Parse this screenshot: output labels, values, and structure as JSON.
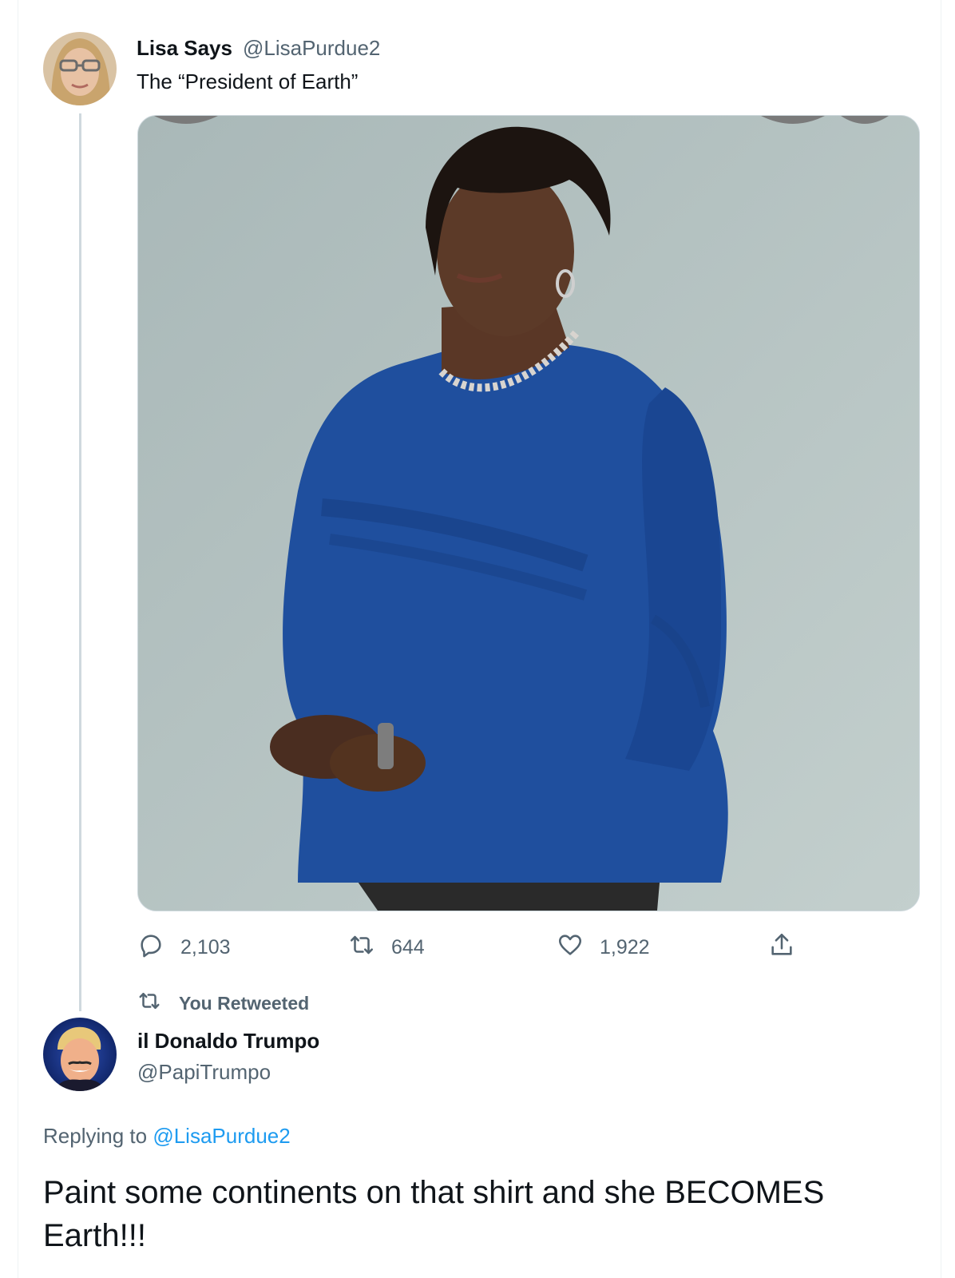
{
  "tweet1": {
    "author_name": "Lisa Says",
    "author_handle": "@LisaPurdue2",
    "text": "The “President of Earth”",
    "stats": {
      "replies": "2,103",
      "retweets": "644",
      "likes": "1,922"
    }
  },
  "retweet_context": {
    "label": "You Retweeted"
  },
  "tweet2": {
    "author_name": "il Donaldo Trumpo",
    "author_handle": "@PapiTrumpo",
    "replying_prefix": "Replying to",
    "replying_to": "@LisaPurdue2",
    "text": "Paint some continents on that shirt and she BECOMES Earth!!!"
  },
  "icons": {
    "reply": "reply-icon",
    "retweet": "retweet-icon",
    "like": "heart-icon",
    "share": "share-icon"
  },
  "colors": {
    "text_primary": "#0f1419",
    "text_secondary": "#536471",
    "link": "#1d9bf0",
    "thread_line": "#cfd9de",
    "photo_background": "#b9c7c7",
    "shirt_blue": "#1f4f9e"
  }
}
